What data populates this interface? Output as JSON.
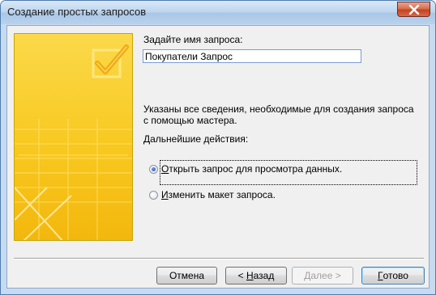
{
  "window": {
    "title": "Создание простых запросов"
  },
  "form": {
    "name_label": "Задайте имя запроса:",
    "query_name_value": "Покупатели Запрос",
    "info_text": "Указаны все сведения, необходимые для создания запроса с помощью мастера.",
    "next_actions_label": "Дальнейшие действия:"
  },
  "options": [
    {
      "label_mnemonic": "О",
      "label_rest": "ткрыть запрос для просмотра данных.",
      "checked": true
    },
    {
      "label_mnemonic": "И",
      "label_rest": "зменить макет запроса.",
      "checked": false
    }
  ],
  "buttons": {
    "cancel": "Отмена",
    "back_prefix": "< ",
    "back_mnemonic": "Н",
    "back_rest": "азад",
    "next": "Далее >",
    "finish_mnemonic": "Г",
    "finish_rest": "отово"
  },
  "colors": {
    "accent_yellow": "#f7c51c",
    "title_blue": "#b9d1ea"
  }
}
